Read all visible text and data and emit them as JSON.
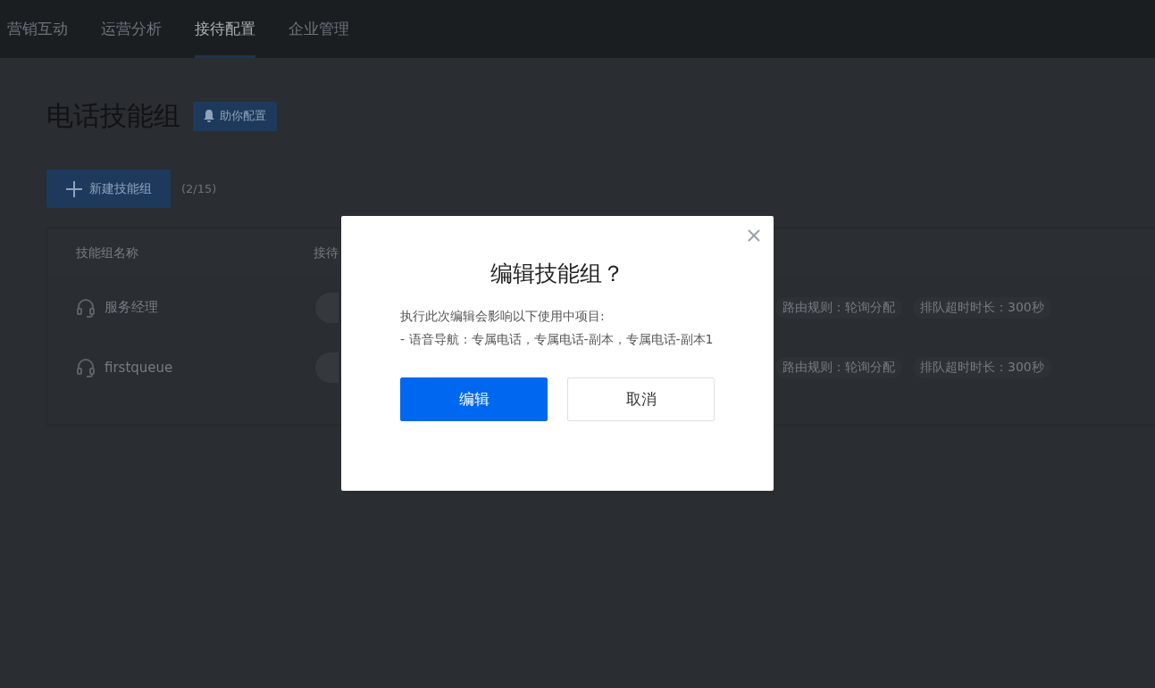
{
  "nav": {
    "tabs": [
      {
        "label": "营销互动",
        "selected": false
      },
      {
        "label": "运营分析",
        "selected": false
      },
      {
        "label": "接待配置",
        "selected": true
      },
      {
        "label": "企业管理",
        "selected": false
      }
    ]
  },
  "page": {
    "title": "电话技能组",
    "help_button": "助你配置",
    "new_button": "新建技能组",
    "count": "(2/15)"
  },
  "table": {
    "columns": [
      "技能组名称",
      "接待"
    ],
    "rows": [
      {
        "name": "服务经理",
        "tags": [
          "路由规则：轮询分配",
          "排队超时时长：300秒"
        ]
      },
      {
        "name": "firstqueue",
        "tags": [
          "路由规则：轮询分配",
          "排队超时时长：300秒"
        ]
      }
    ]
  },
  "dialog": {
    "title": "编辑技能组？",
    "message": "执行此次编辑会影响以下使用中项目:",
    "detail": "- 语音导航：专属电话，专属电话-副本，专属电话-副本1",
    "buttons": [
      {
        "label": "编辑",
        "kind": "primary"
      },
      {
        "label": "取消",
        "kind": "default"
      }
    ]
  }
}
